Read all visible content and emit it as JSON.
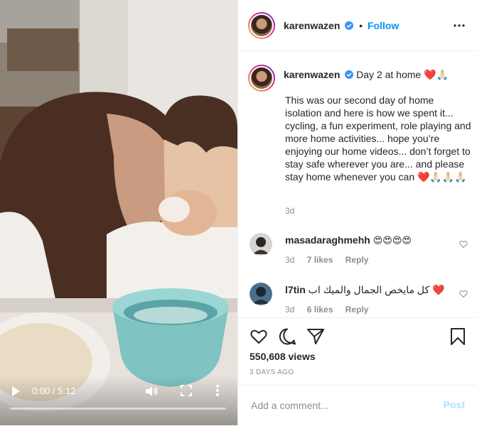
{
  "video": {
    "time_display": "0:00 / 5:12",
    "progress": 0,
    "play_icon": "play-icon",
    "volume_icon": "volume-icon",
    "fullscreen_icon": "fullscreen-icon",
    "more_icon": "more-vertical-icon"
  },
  "header": {
    "username": "karenwazen",
    "separator": "•",
    "follow_label": "Follow"
  },
  "caption": {
    "username": "karenwazen",
    "title": "Day 2 at home",
    "title_emoji": "❤️🙏🏻",
    "text": "This was our second day of home isolation and here is how we spent it... cycling, a fun experiment, role playing and more home activities... hope you’re enjoying our home videos... don’t forget to stay safe wherever you are... and please stay home whenever you can",
    "text_emoji": "❤️🙏🏻🙏🏻🙏🏻",
    "age": "3d"
  },
  "comments": [
    {
      "username": "masadaraghmehh",
      "text": "😍😍😍😍",
      "age": "3d",
      "likes": "7 likes",
      "reply_label": "Reply"
    },
    {
      "username": "l7tin",
      "text": "كل مايخص الجمال والميك اب",
      "text_emoji": "❤️",
      "age": "3d",
      "likes": "6 likes",
      "reply_label": "Reply"
    }
  ],
  "actions": {
    "views": "550,608 views",
    "posted": "3 DAYS AGO"
  },
  "add_comment": {
    "placeholder": "Add a comment...",
    "post_label": "Post"
  },
  "colors": {
    "link_blue": "#0095f6",
    "post_disabled": "#b2dffc",
    "muted": "#8e8e8e",
    "text": "#262626",
    "border": "#efefef"
  }
}
